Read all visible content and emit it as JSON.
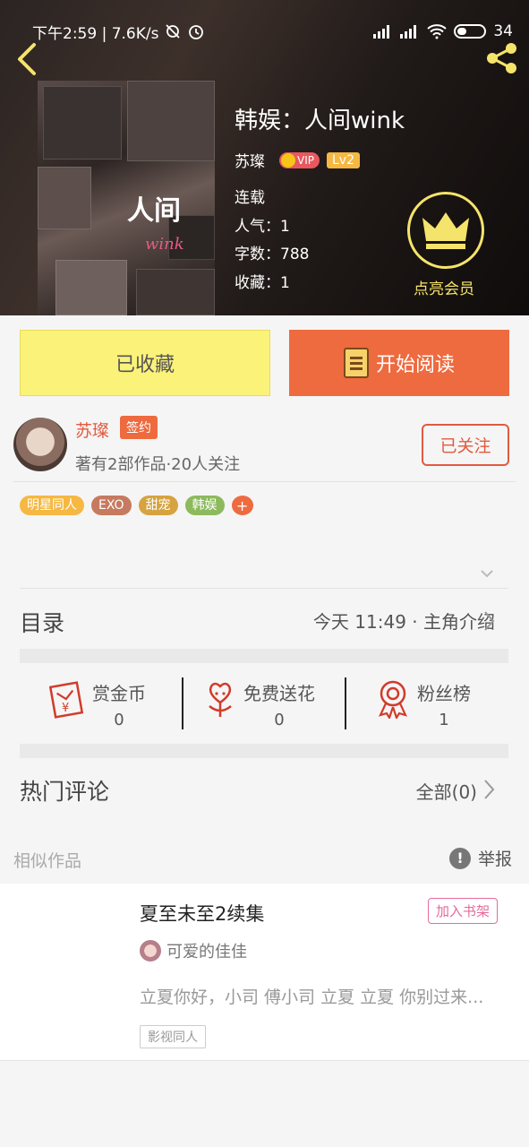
{
  "status_bar": {
    "time_speed": "下午2:59 | 7.6K/s",
    "battery": "34"
  },
  "book": {
    "title": "韩娱：人间wink",
    "cover_text": "人间",
    "cover_subtext": "wink",
    "author": "苏璨",
    "vip_label": "VIP",
    "level": "Lv2",
    "status": "连载",
    "popularity": "人气：1",
    "word_count": "字数：788",
    "favorites": "收藏：1"
  },
  "vip_promo": {
    "label": "点亮会员"
  },
  "actions": {
    "favorited_label": "已收藏",
    "read_label": "开始阅读"
  },
  "author_card": {
    "name": "苏璨",
    "sign_badge": "签约",
    "subtitle": "著有2部作品·20人关注",
    "follow_label": "已关注"
  },
  "tags": [
    {
      "label": "明星同人",
      "color": "#f5b842"
    },
    {
      "label": "EXO",
      "color": "#c67a5f"
    },
    {
      "label": "甜宠",
      "color": "#d6a341"
    },
    {
      "label": "韩娱",
      "color": "#8cba5c"
    }
  ],
  "tag_more": "+",
  "toc": {
    "label": "目录",
    "latest": "今天 11:49 · 主角介绍"
  },
  "stats": [
    {
      "label": "赏金币",
      "value": "0",
      "icon": "red-envelope-icon"
    },
    {
      "label": "免费送花",
      "value": "0",
      "icon": "flower-icon"
    },
    {
      "label": "粉丝榜",
      "value": "1",
      "icon": "medal-icon"
    }
  ],
  "comments": {
    "label": "热门评论",
    "all_label": "全部(0)"
  },
  "similar": {
    "label": "相似作品",
    "report_label": "举报"
  },
  "recommendation": {
    "title": "夏至未至2续集",
    "add_label": "加入书架",
    "author": "可爱的佳佳",
    "description": "立夏你好，小司 傅小司 立夏 立夏 你别过来...",
    "tag": "影视同人"
  },
  "colors": {
    "accent": "#ee6a3f",
    "favorite_bg": "#fbf27a",
    "author_red": "#e25a3f",
    "vip_gold": "#f5e46b"
  }
}
